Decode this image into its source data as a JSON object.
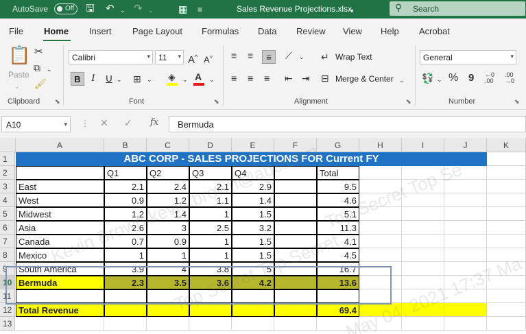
{
  "titlebar": {
    "autosave_label": "AutoSave",
    "autosave_state": "Off",
    "file_title": "Sales Revenue Projections.xlsx",
    "search_placeholder": "Search",
    "accent": "#217346"
  },
  "tabs": [
    "File",
    "Home",
    "Insert",
    "Page Layout",
    "Formulas",
    "Data",
    "Review",
    "View",
    "Help",
    "Acrobat"
  ],
  "active_tab": "Home",
  "ribbon": {
    "clipboard": {
      "paste_label": "Paste",
      "group_label": "Clipboard"
    },
    "font": {
      "font_name": "Calibri",
      "font_size": "11",
      "bold": "B",
      "italic": "I",
      "underline": "U",
      "group_label": "Font",
      "grow": "A^",
      "shrink": "A˅"
    },
    "alignment": {
      "wrap_text": "Wrap Text",
      "merge_center": "Merge & Center",
      "group_label": "Alignment"
    },
    "number": {
      "format": "General",
      "percent": "%",
      "comma": "9",
      "group_label": "Number"
    }
  },
  "formula_bar": {
    "name_box": "A10",
    "formula": "Bermuda"
  },
  "sheet": {
    "columns": [
      "A",
      "B",
      "C",
      "D",
      "E",
      "F",
      "G",
      "H",
      "I",
      "J",
      "K"
    ],
    "rows": [
      "1",
      "2",
      "3",
      "4",
      "5",
      "6",
      "7",
      "8",
      "9",
      "10",
      "11",
      "12",
      "13"
    ],
    "selected_row": "10",
    "title": "ABC CORP  - SALES PROJECTIONS FOR Current FY",
    "header_row": {
      "q1": "Q1",
      "q2": "Q2",
      "q3": "Q3",
      "q4": "Q4",
      "total": "Total"
    },
    "data_rows": [
      {
        "region": "East",
        "q1": "2.1",
        "q2": "2.4",
        "q3": "2.1",
        "q4": "2.9",
        "total": "9.5"
      },
      {
        "region": "West",
        "q1": "0.9",
        "q2": "1.2",
        "q3": "1.1",
        "q4": "1.4",
        "total": "4.6"
      },
      {
        "region": "Midwest",
        "q1": "1.2",
        "q2": "1.4",
        "q3": "1",
        "q4": "1.5",
        "total": "5.1"
      },
      {
        "region": "Asia",
        "q1": "2.6",
        "q2": "3",
        "q3": "2.5",
        "q4": "3.2",
        "total": "11.3"
      },
      {
        "region": "Canada",
        "q1": "0.7",
        "q2": "0.9",
        "q3": "1",
        "q4": "1.5",
        "total": "4.1"
      },
      {
        "region": "Mexico",
        "q1": "1",
        "q2": "1",
        "q3": "1",
        "q4": "1.5",
        "total": "4.5"
      },
      {
        "region": "South America",
        "q1": "3.9",
        "q2": "4",
        "q3": "3.8",
        "q4": "5",
        "total": "16.7"
      },
      {
        "region": "Bermuda",
        "q1": "2.3",
        "q2": "3.5",
        "q3": "3.6",
        "q4": "4.2",
        "total": "13.6"
      }
    ],
    "total_row": {
      "label": "Total Revenue",
      "total": "69.4"
    },
    "colors": {
      "title_bar": "#1f72c4",
      "highlight": "#ffff00",
      "selected_fill": "#b7b72e"
    }
  },
  "watermark": {
    "text_1": "Kevin Brown kevin.brown@abc.com",
    "text_2": "Top Secret Top Secret",
    "text_3": "May 04, 2021 17:37 Ma",
    "text_4": "Top Secret Top Se"
  }
}
